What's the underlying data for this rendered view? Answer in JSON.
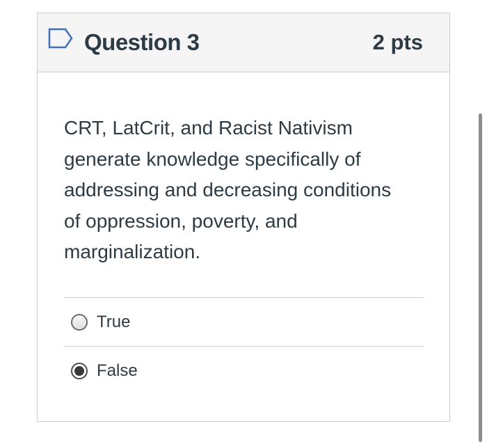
{
  "question": {
    "title": "Question 3",
    "points": "2 pts",
    "text": "CRT, LatCrit, and Racist Nativism generate knowledge specifically of addressing and decreasing conditions of oppression, poverty, and marginalization.",
    "flag_icon": "flag-outline-icon"
  },
  "answers": [
    {
      "label": "True",
      "selected": false
    },
    {
      "label": "False",
      "selected": true
    }
  ],
  "colors": {
    "header_bg": "#f5f5f5",
    "border": "#c7cdd1",
    "text": "#2d3b45",
    "flag": "#3f6fb5"
  }
}
